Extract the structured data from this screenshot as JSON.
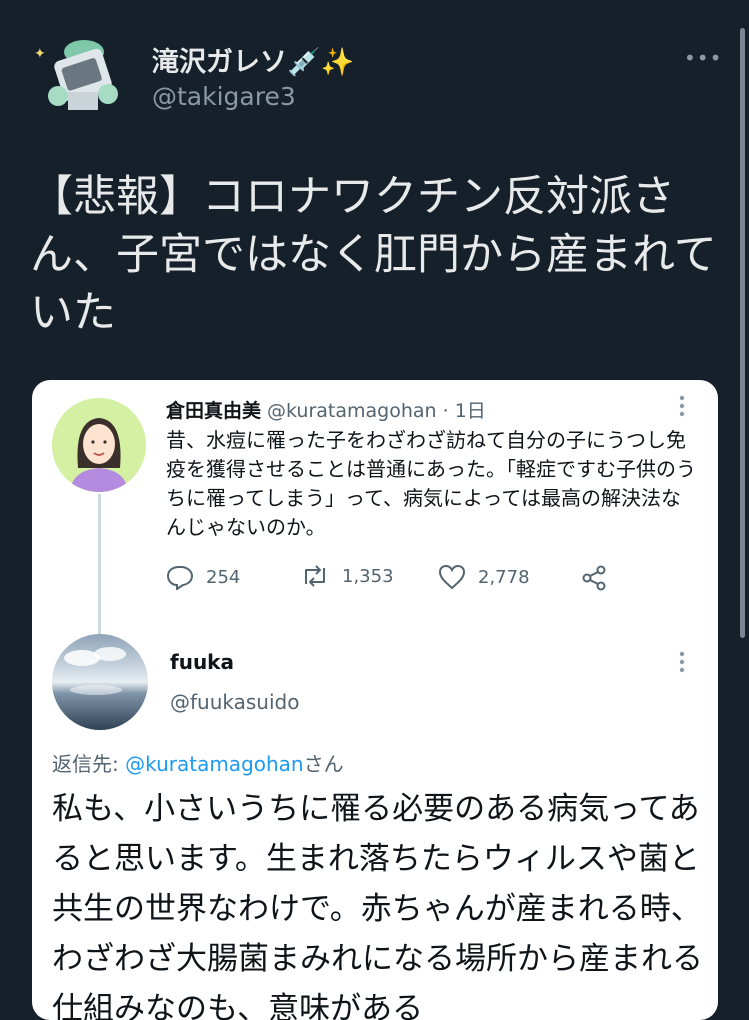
{
  "author": {
    "name": "滝沢ガレソ💉✨",
    "handle": "@takigare3"
  },
  "tweet": {
    "text": "【悲報】コロナワクチン反対派さん、子宮ではなく肛門から産まれていた"
  },
  "more_label": "•••",
  "quoted": {
    "original": {
      "name": "倉田真由美",
      "handle_meta": "@kuratamagohan · 1日",
      "text": "昔、水痘に罹った子をわざわざ訪ねて自分の子にうつし免疫を獲得させることは普通にあった。「軽症ですむ子供のうちに罹ってしまう」って、病気によっては最高の解決法なんじゃないのか。",
      "replies": "254",
      "retweets": "1,353",
      "likes": "2,778"
    },
    "reply": {
      "name": "fuuka",
      "handle": "@fuukasuido",
      "reply_to_prefix": "返信先: ",
      "reply_to_handle": "@kuratamagohan",
      "reply_to_suffix": "さん",
      "text": "私も、小さいうちに罹る必要のある病気ってあると思います。生まれ落ちたらウィルスや菌と共生の世界なわけで。赤ちゃんが産まれる時、わざわざ大腸菌まみれになる場所から産まれる仕組みなのも、意味がある"
    }
  },
  "colors": {
    "background": "#15202b",
    "card": "#ffffff",
    "link": "#1d9bf0",
    "muted": "#8b98a5"
  }
}
